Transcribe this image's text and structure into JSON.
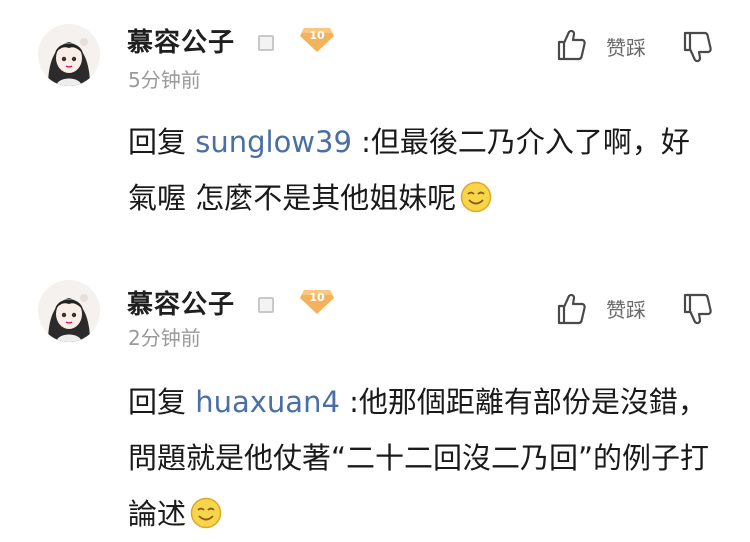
{
  "comments": [
    {
      "username": "慕容公子",
      "vip_level": "10",
      "timestamp": "5分钟前",
      "like_label": "赞踩",
      "reply_prefix": "回复",
      "reply_to": "sunglow39",
      "text": " :但最後二乃介入了啊，好氣喔 怎麼不是其他姐妹呢",
      "emoji": "smiling-face-emoji"
    },
    {
      "username": "慕容公子",
      "vip_level": "10",
      "timestamp": "2分钟前",
      "like_label": "赞踩",
      "reply_prefix": "回复",
      "reply_to": "huaxuan4",
      "text": " :他那個距離有部份是沒錯，問題就是他仗著“二十二回沒二乃回”的例子打論述",
      "emoji": "smiling-face-emoji"
    }
  ],
  "colors": {
    "username": "#1f1f1f",
    "timestamp": "#9a9a9a",
    "reply_user": "#4a6fa5",
    "vip_badge": "#f5b25c"
  },
  "icons": [
    "thumbs-up-icon",
    "thumbs-down-icon",
    "vip-badge-icon",
    "level-box-icon"
  ]
}
